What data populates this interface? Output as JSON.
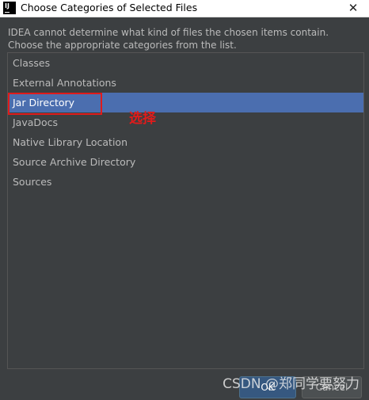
{
  "window": {
    "title": "Choose Categories of Selected Files",
    "icon_text": "IJ",
    "close_glyph": "✕"
  },
  "message": {
    "line1": "IDEA cannot determine what kind of files the chosen items contain.",
    "line2": "Choose the appropriate categories from the list."
  },
  "categories": {
    "items": [
      {
        "label": "Classes",
        "selected": false
      },
      {
        "label": "External Annotations",
        "selected": false
      },
      {
        "label": "Jar Directory",
        "selected": true
      },
      {
        "label": "JavaDocs",
        "selected": false
      },
      {
        "label": "Native Library Location",
        "selected": false
      },
      {
        "label": "Source Archive Directory",
        "selected": false
      },
      {
        "label": "Sources",
        "selected": false
      }
    ]
  },
  "annotation": {
    "text": "选择",
    "color": "#e01b1b"
  },
  "buttons": {
    "ok_label": "OK",
    "cancel_label": "Cancel"
  },
  "watermark": {
    "text": "CSDN @郑同学要努力"
  },
  "colors": {
    "dialog_bg": "#3c3f41",
    "selection": "#4b6eaf",
    "text": "#bbbbbb"
  }
}
